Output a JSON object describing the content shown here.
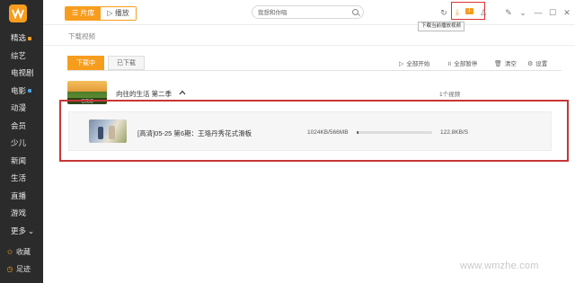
{
  "sidebar": {
    "items": [
      {
        "label": "精选",
        "dot": "#f79d1e"
      },
      {
        "label": "综艺"
      },
      {
        "label": "电视剧"
      },
      {
        "label": "电影",
        "dot": "#4aa3df"
      },
      {
        "label": "动漫"
      },
      {
        "label": "会员"
      },
      {
        "label": "少儿"
      },
      {
        "label": "新闻"
      },
      {
        "label": "生活"
      },
      {
        "label": "直播"
      },
      {
        "label": "游戏"
      },
      {
        "label": "更多",
        "suffix": "⌄"
      }
    ],
    "bottom": [
      {
        "label": "收藏",
        "icon": "star-icon"
      },
      {
        "label": "足迹",
        "icon": "footprint-icon"
      }
    ]
  },
  "topbar": {
    "segment": {
      "library_label": "片库",
      "play_label": "播放",
      "library_glyph": "☰",
      "play_glyph": "▷"
    },
    "search": {
      "placeholder": "我想和你唱"
    },
    "download_badge": "1",
    "tooltip": "下载当前播放视频"
  },
  "main": {
    "page_title": "下载视频",
    "tabs": [
      {
        "label": "下载中",
        "active": true
      },
      {
        "label": "已下载",
        "active": false
      }
    ],
    "actions": [
      {
        "label": "全部开始",
        "icon": "play-icon",
        "glyph": "▷"
      },
      {
        "label": "全部暂停",
        "icon": "pause-icon",
        "glyph": "॥"
      },
      {
        "label": "清空",
        "icon": "trash-icon",
        "glyph": "🗑"
      },
      {
        "label": "设置",
        "icon": "gear-icon",
        "glyph": "⚙"
      }
    ],
    "group": {
      "title": "向往的生活 第二季",
      "count": "1个视频",
      "thumb_caption": "已完结"
    },
    "row": {
      "title": "[高清]05-25 第6期：王珞丹秀花式滑板",
      "size": "1024KB/566MB",
      "progress": 0.02,
      "speed": "122.8KB/S"
    }
  },
  "watermark": "www.wmzhe.com",
  "colors": {
    "accent": "#f79d1e",
    "sidebar": "#2b2b2b",
    "highlight": "#c73636"
  }
}
